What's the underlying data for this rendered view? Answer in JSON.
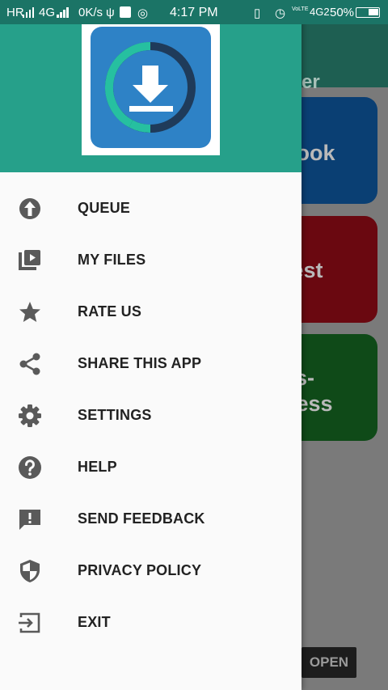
{
  "status_bar": {
    "left_signal": "HR",
    "network1": "4G",
    "speed": "0K/s",
    "time": "4:17 PM",
    "volte": "VoLTE",
    "network2": "4G2",
    "battery": "50%"
  },
  "app": {
    "title_fragment": "er",
    "cards": [
      {
        "text": "book",
        "color": "#1565c0"
      },
      {
        "text": "rest",
        "color": "#c4001d"
      },
      {
        "text": "ks-",
        "text2": "ness",
        "color": "#1b7a2b"
      }
    ],
    "open_button": "OPEN"
  },
  "drawer": {
    "header_color": "#26a08a",
    "logo_color": "#2e82c6",
    "menu": [
      {
        "label": "QUEUE",
        "icon": "upload-arrow-icon"
      },
      {
        "label": "MY FILES",
        "icon": "video-library-icon"
      },
      {
        "label": "RATE US",
        "icon": "star-icon"
      },
      {
        "label": "SHARE THIS APP",
        "icon": "share-icon"
      },
      {
        "label": "SETTINGS",
        "icon": "gear-icon"
      },
      {
        "label": "HELP",
        "icon": "help-icon"
      },
      {
        "label": "SEND FEEDBACK",
        "icon": "feedback-icon"
      },
      {
        "label": "PRIVACY POLICY",
        "icon": "shield-icon"
      },
      {
        "label": "EXIT",
        "icon": "exit-icon"
      }
    ]
  }
}
